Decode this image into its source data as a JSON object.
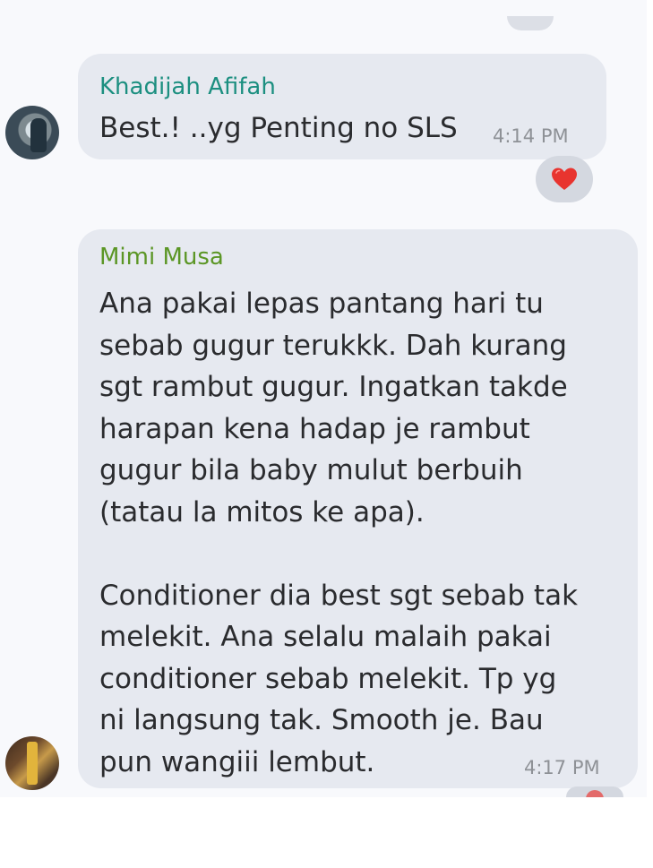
{
  "messages": [
    {
      "sender": "Khadijah Afifah",
      "text": "Best.! ..yg Penting no SLS",
      "time": "4:14 PM",
      "reaction": "heart"
    },
    {
      "sender": "Mimi Musa",
      "lines": [
        "Ana pakai lepas pantang hari tu",
        "sebab gugur terukkk. Dah kurang",
        "sgt rambut gugur. Ingatkan takde",
        "harapan kena hadap je rambut",
        "gugur bila baby mulut berbuih",
        "(tatau la mitos ke apa).",
        "",
        "Conditioner dia best sgt sebab tak",
        "melekit. Ana selalu malaih pakai",
        "conditioner sebab melekit. Tp yg",
        "ni langsung tak. Smooth je. Bau",
        "pun wangiii lembut."
      ],
      "time": "4:17 PM"
    }
  ],
  "colors": {
    "chat_background": "#f8f9fc",
    "bubble": "#e6e9f0",
    "sender_1": "#1c8f80",
    "sender_2": "#5b9625",
    "reaction_heart": "#e8342f",
    "timestamp": "#8e9196"
  },
  "icons": [
    "heart-reaction-icon",
    "user-avatar"
  ]
}
